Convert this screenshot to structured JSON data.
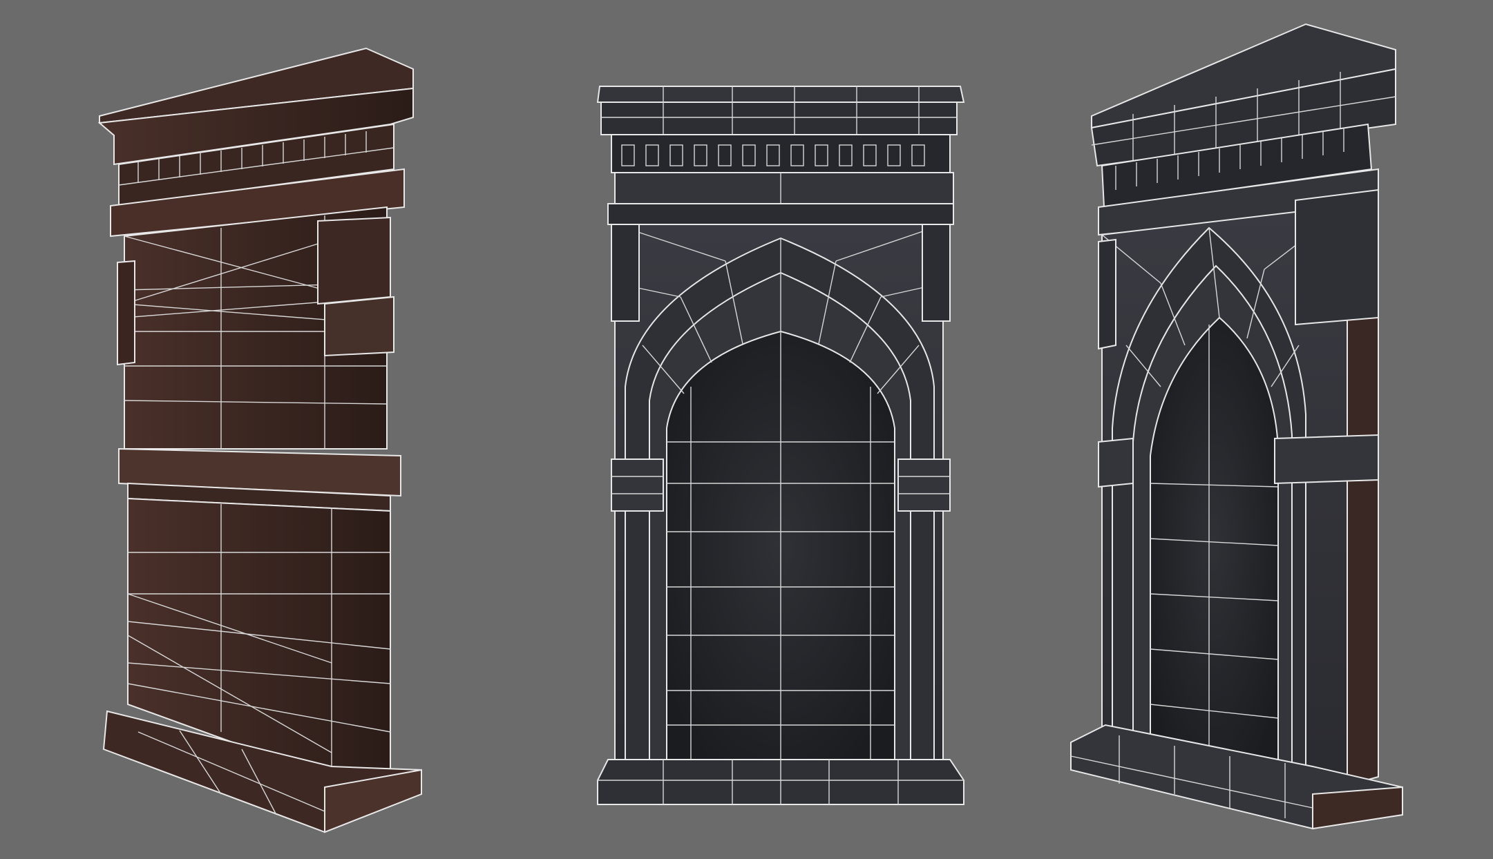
{
  "scene": {
    "background_color": "#6b6b6b",
    "wireframe_color": "#e8e8e8",
    "stone_colors": [
      "#3a2723",
      "#2e2f35",
      "#1f2024"
    ],
    "views": [
      {
        "id": "side-view",
        "kind": "side-angle-view",
        "material": "brown-stone"
      },
      {
        "id": "front-view",
        "kind": "front-view",
        "material": "dark-stone"
      },
      {
        "id": "three-quarter-view",
        "kind": "three-quarter-view",
        "material": "dark-stone"
      }
    ]
  }
}
